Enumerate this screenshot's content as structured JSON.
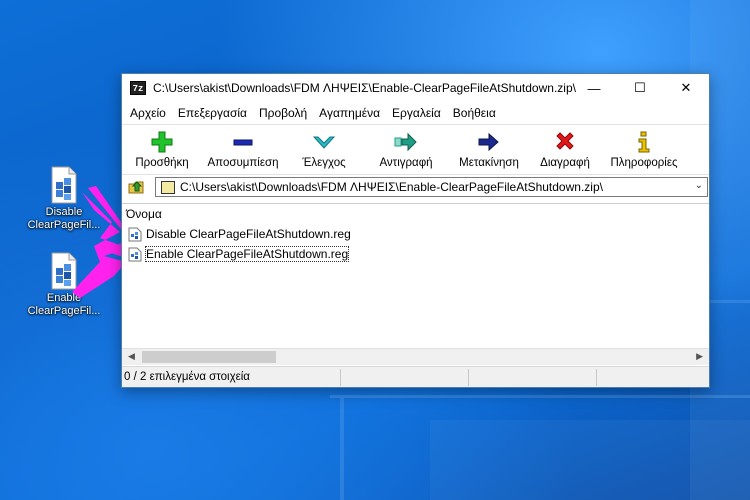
{
  "desktop": {
    "icons": [
      {
        "line1": "Disable",
        "line2": "ClearPageFil..."
      },
      {
        "line1": "Enable",
        "line2": "ClearPageFil..."
      }
    ],
    "arrow_color": "#ff22ee"
  },
  "window": {
    "app_icon": "7z",
    "title": "C:\\Users\\akist\\Downloads\\FDM ΛΗΨΕΙΣ\\Enable-ClearPageFileAtShutdown.zip\\",
    "controls": {
      "minimize": "—",
      "maximize": "☐",
      "close": "✕"
    },
    "menu": [
      "Αρχείο",
      "Επεξεργασία",
      "Προβολή",
      "Αγαπημένα",
      "Εργαλεία",
      "Βοήθεια"
    ],
    "toolbar": [
      {
        "label": "Προσθήκη",
        "icon": "add-icon",
        "color": "#22c22c"
      },
      {
        "label": "Αποσυμπίεση",
        "icon": "extract-icon",
        "color": "#1a2bb0"
      },
      {
        "label": "Έλεγχος",
        "icon": "test-icon",
        "color": "#2bb7c4"
      },
      {
        "label": "Αντιγραφή",
        "icon": "copy-icon",
        "color": "#1f9e86"
      },
      {
        "label": "Μετακίνηση",
        "icon": "move-icon",
        "color": "#1a2b8c"
      },
      {
        "label": "Διαγραφή",
        "icon": "delete-icon",
        "color": "#e01818"
      },
      {
        "label": "Πληροφορίες",
        "icon": "info-icon",
        "color": "#e8c400"
      }
    ],
    "address": "C:\\Users\\akist\\Downloads\\FDM ΛΗΨΕΙΣ\\Enable-ClearPageFileAtShutdown.zip\\",
    "list": {
      "column": "Όνομα",
      "rows": [
        "Disable ClearPageFileAtShutdown.reg",
        "Enable ClearPageFileAtShutdown.reg"
      ]
    },
    "status": "0 / 2 επιλεγμένα στοιχεία"
  }
}
